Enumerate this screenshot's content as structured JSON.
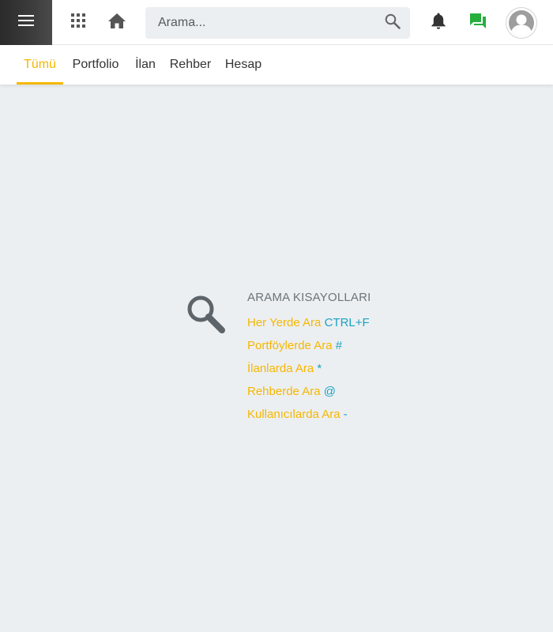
{
  "topbar": {
    "search_placeholder": "Arama...",
    "icons": [
      "menu-icon",
      "apps-icon",
      "home-icon",
      "search-icon",
      "bell-icon",
      "chat-icon",
      "avatar-icon"
    ],
    "colors": {
      "menu_bg": "#333333",
      "chat": "#27ae3d",
      "icon": "#555555"
    }
  },
  "tabs": [
    {
      "label": "Tümü",
      "active": true
    },
    {
      "label": "Portfolio",
      "active": false
    },
    {
      "label": "İlan",
      "active": false
    },
    {
      "label": "Rehber",
      "active": false
    },
    {
      "label": "Hesap",
      "active": false
    }
  ],
  "shortcuts": {
    "title": "ARAMA KISAYOLLARI",
    "items": [
      {
        "label": "Her Yerde Ara",
        "key": "CTRL+F"
      },
      {
        "label": "Portföylerde Ara",
        "key": "#"
      },
      {
        "label": "İlanlarda Ara",
        "key": "*"
      },
      {
        "label": "Rehberde Ara",
        "key": "@"
      },
      {
        "label": "Kullanıcılarda Ara",
        "key": "-"
      }
    ],
    "colors": {
      "label": "#f5b700",
      "key": "#1ba2c4",
      "title": "#6b747a"
    }
  },
  "theme": {
    "accent": "#f5b700",
    "background": "#eceff1"
  }
}
